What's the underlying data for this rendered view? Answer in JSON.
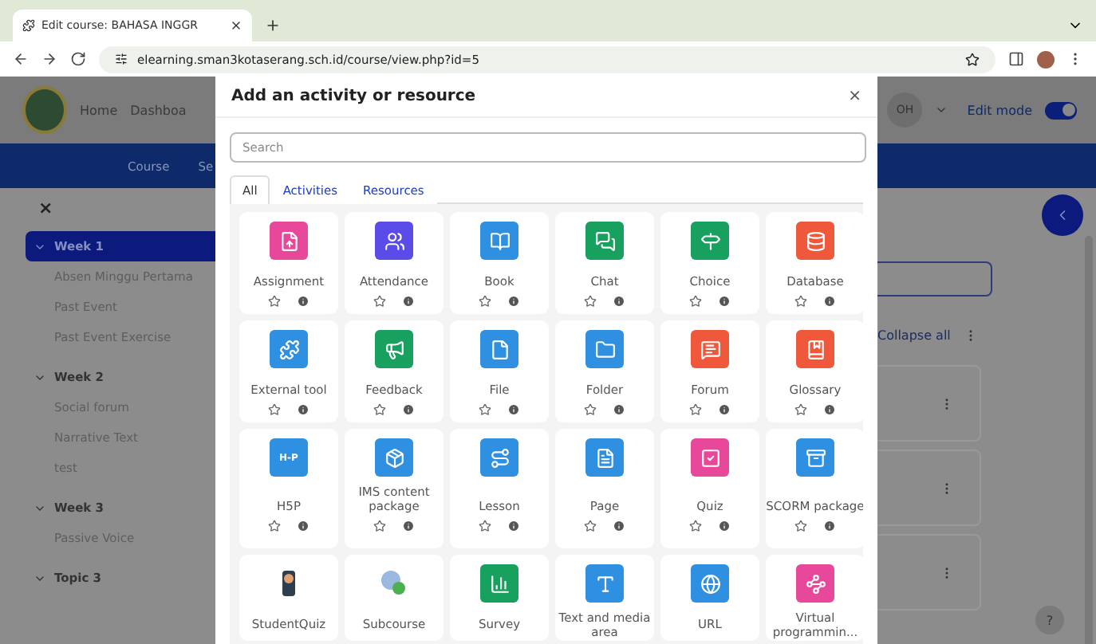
{
  "browser": {
    "tab_title": "Edit course: BAHASA INGGR",
    "address": "elearning.sman3kotaserang.sch.id/course/view.php?id=5"
  },
  "header": {
    "nav": [
      "Home",
      "Dashboa"
    ],
    "avatar": "OH",
    "edit_mode": {
      "label": "Edit mode",
      "on": true
    }
  },
  "course_nav": [
    "Course",
    "Se"
  ],
  "drawer": {
    "close": "×",
    "sections": [
      {
        "label": "Week 1",
        "selected": true,
        "expanded": true,
        "children": [
          {
            "label": "Absen Minggu Pertama"
          },
          {
            "label": "Past Event"
          },
          {
            "label": "Past Event Exercise"
          }
        ]
      },
      {
        "label": "Week 2",
        "selected": false,
        "expanded": true,
        "children": [
          {
            "label": "Social forum"
          },
          {
            "label": "Narrative Text"
          },
          {
            "label": "test"
          }
        ]
      },
      {
        "label": "Week 3",
        "selected": false,
        "expanded": true,
        "children": [
          {
            "label": "Passive Voice"
          }
        ]
      },
      {
        "label": "Topic 3",
        "selected": false,
        "expanded": true
      }
    ]
  },
  "content": {
    "collapse_all": "Collapse all",
    "help": "?"
  },
  "modal": {
    "title": "Add an activity or resource",
    "close": "×",
    "search": {
      "placeholder": "Search"
    },
    "tabs": [
      {
        "label": "All",
        "selected": true
      },
      {
        "label": "Activities",
        "selected": false
      },
      {
        "label": "Resources",
        "selected": false
      }
    ],
    "items": [
      {
        "name": "Assignment",
        "kind": "tile",
        "color": "#e8489a",
        "actions_shown": true
      },
      {
        "name": "Attendance",
        "kind": "tile",
        "color": "#5b4be8",
        "actions_shown": true
      },
      {
        "name": "Book",
        "kind": "tile",
        "color": "#2f8fe0",
        "actions_shown": true
      },
      {
        "name": "Chat",
        "kind": "tile",
        "color": "#18a05e",
        "actions_shown": true
      },
      {
        "name": "Choice",
        "kind": "tile",
        "color": "#18a05e",
        "actions_shown": true
      },
      {
        "name": "Database",
        "kind": "tile",
        "color": "#f0583c",
        "actions_shown": true
      },
      {
        "name": "External tool",
        "kind": "tile",
        "color": "#2f8fe0",
        "actions_shown": true
      },
      {
        "name": "Feedback",
        "kind": "tile",
        "color": "#18a05e",
        "actions_shown": true
      },
      {
        "name": "File",
        "kind": "tile",
        "color": "#2f8fe0",
        "actions_shown": true
      },
      {
        "name": "Folder",
        "kind": "tile",
        "color": "#2f8fe0",
        "actions_shown": true
      },
      {
        "name": "Forum",
        "kind": "tile",
        "color": "#f0583c",
        "actions_shown": true
      },
      {
        "name": "Glossary",
        "kind": "tile",
        "color": "#f0583c",
        "actions_shown": true
      },
      {
        "name": "H5P",
        "kind": "tile",
        "color": "#2f8fe0",
        "badge": "H-P",
        "actions_shown": true
      },
      {
        "name": "IMS content package",
        "kind": "tile",
        "color": "#2f8fe0",
        "actions_shown": true
      },
      {
        "name": "Lesson",
        "kind": "tile",
        "color": "#2f8fe0",
        "actions_shown": true
      },
      {
        "name": "Page",
        "kind": "tile",
        "color": "#2f8fe0",
        "actions_shown": true
      },
      {
        "name": "Quiz",
        "kind": "tile",
        "color": "#e8489a",
        "actions_shown": true
      },
      {
        "name": "SCORM package",
        "kind": "tile",
        "color": "#2f8fe0",
        "actions_shown": true
      },
      {
        "name": "StudentQuiz",
        "kind": "plugin",
        "actions_shown": false
      },
      {
        "name": "Subcourse",
        "kind": "plugin",
        "actions_shown": false
      },
      {
        "name": "Survey",
        "kind": "tile",
        "color": "#18a05e",
        "actions_shown": false
      },
      {
        "name": "Text and media area",
        "kind": "tile",
        "color": "#2f8fe0",
        "actions_shown": false
      },
      {
        "name": "URL",
        "kind": "tile",
        "color": "#2f8fe0",
        "actions_shown": false
      },
      {
        "name": "Virtual programmin...",
        "kind": "tile",
        "color": "#e8489a",
        "actions_shown": false
      }
    ]
  }
}
